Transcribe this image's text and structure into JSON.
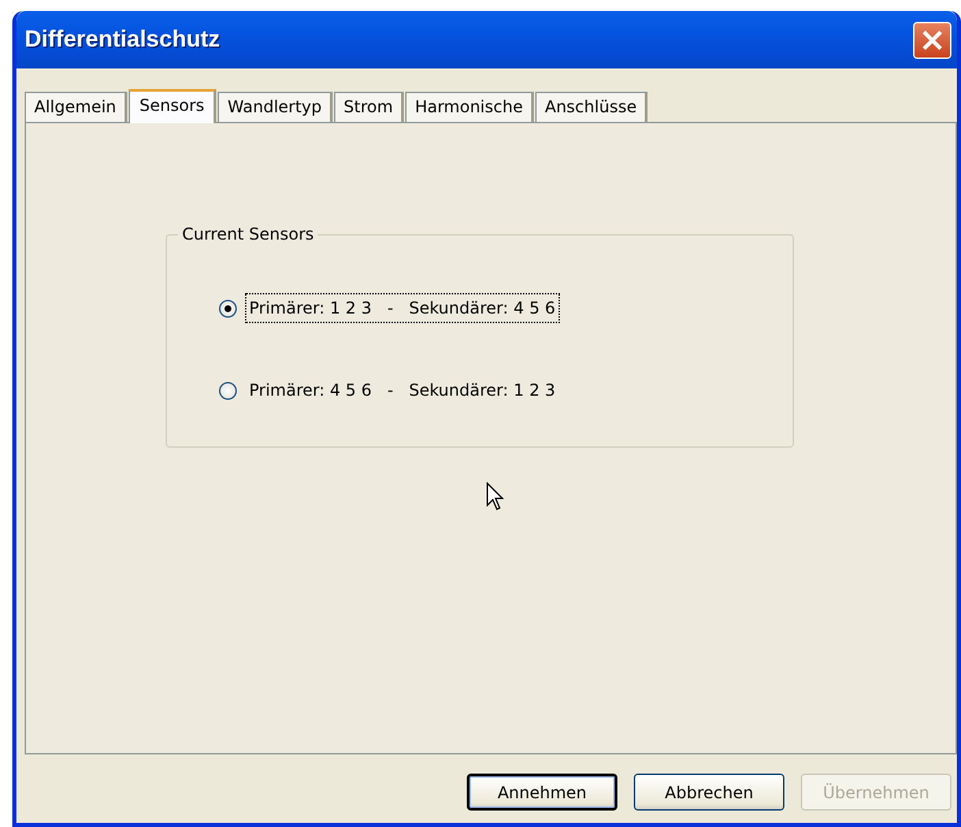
{
  "window": {
    "title": "Differentialschutz",
    "close": "×"
  },
  "tabs": [
    {
      "label": "Allgemein",
      "selected": false
    },
    {
      "label": "Sensors",
      "selected": true
    },
    {
      "label": "Wandlertyp",
      "selected": false
    },
    {
      "label": "Strom",
      "selected": false
    },
    {
      "label": "Harmonische",
      "selected": false
    },
    {
      "label": "Anschlüsse",
      "selected": false
    }
  ],
  "group": {
    "title": "Current Sensors",
    "options": [
      {
        "label": "Primärer: 1 2 3   -   Sekundärer: 4 5 6",
        "selected": true
      },
      {
        "label": "Primärer: 4 5 6   -   Sekundärer: 1 2 3",
        "selected": false
      }
    ]
  },
  "buttons": [
    {
      "label": "Annehmen",
      "default": true,
      "disabled": false
    },
    {
      "label": "Abbrechen",
      "default": false,
      "disabled": false
    },
    {
      "label": "Übernehmen",
      "default": false,
      "disabled": true
    }
  ]
}
